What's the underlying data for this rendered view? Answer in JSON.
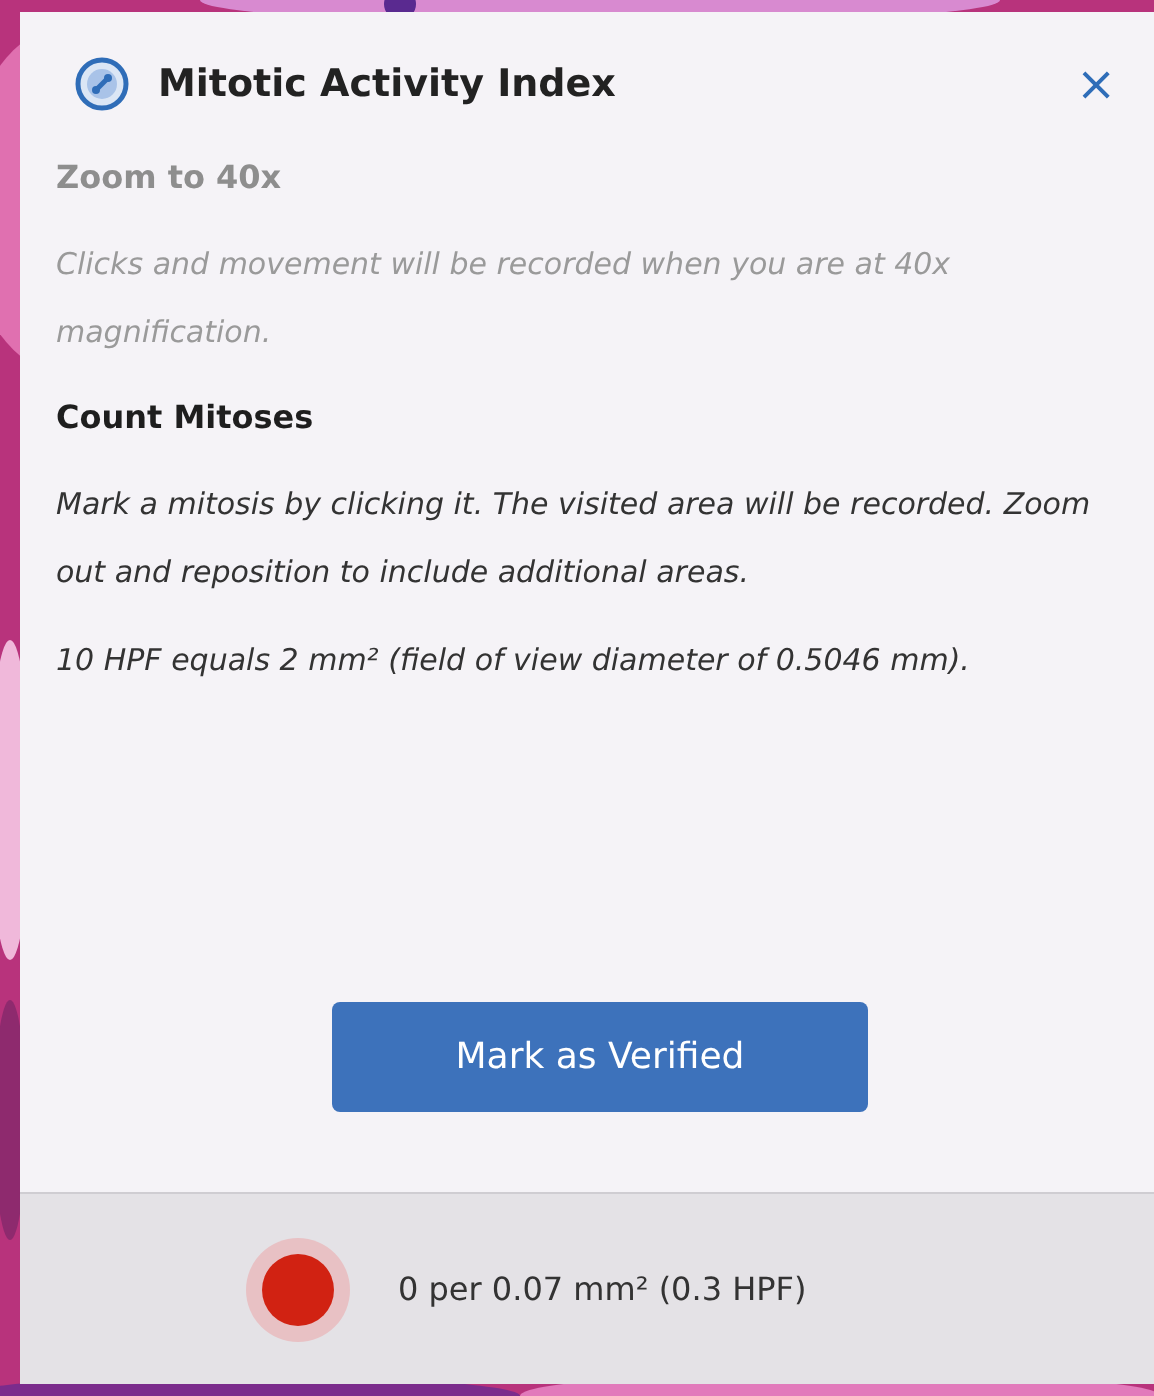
{
  "panel": {
    "title": "Mitotic Activity Index",
    "close": "×"
  },
  "steps": [
    {
      "heading": "Zoom to 40x",
      "disabled": true,
      "paragraphs": [
        "Clicks and movement will be recorded when you are at 40x magnification."
      ]
    },
    {
      "heading": "Count Mitoses",
      "disabled": false,
      "paragraphs": [
        "Mark a mitosis by clicking it. The visited area will be recorded. Zoom out and reposition to include additional areas.",
        "10 HPF equals 2 mm² (field of view diameter of 0.5046 mm)."
      ]
    }
  ],
  "button": "Mark as Verified",
  "footer": {
    "recording": true,
    "reading": "0 per 0.07 mm² (0.3 HPF)"
  }
}
